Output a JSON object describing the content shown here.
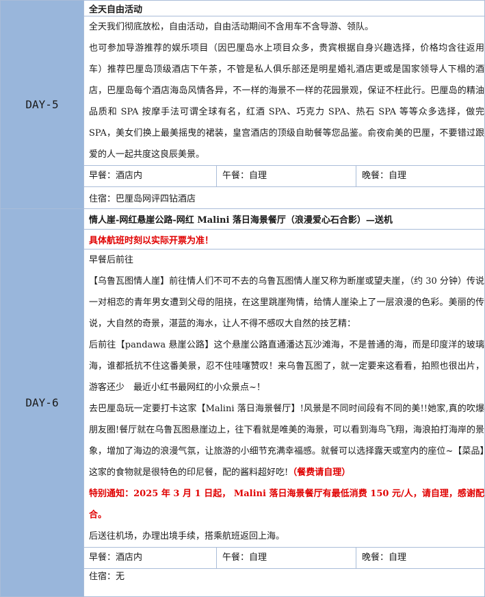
{
  "day5": {
    "label": "DAY-5",
    "title": "全天自由活动",
    "paragraphs": [
      "全天我们彻底放松，自由活动，自由活动期间不含用车不含导游、领队。",
      "也可参加导游推荐的娱乐项目（因巴厘岛水上项目众多，贵宾根据自身兴趣选择，价格均含往返用车）推荐巴厘岛顶级酒店下午茶，不管是私人俱乐部还是明星婚礼酒店更或是国家领导人下榻的酒店，巴厘岛每个酒店海岛风情各异，不一样的海景不一样的花园景观，保证不枉此行。巴厘岛的精油品质和 SPA 按摩手法可谓全球有名，红酒 SPA、巧克力 SPA、热石 SPA 等等众多选择，做完 SPA，美女们换上最美摇曳的裙装，皇宫酒店的顶级自助餐等您品鉴。俞夜俞美的巴厘，不要错过跟爱的人一起共度这良辰美景。"
    ],
    "breakfast": "早餐：酒店内",
    "lunch": "午餐：自理",
    "dinner": "晚餐：自理",
    "stay": "住宿：巴厘岛网评四钻酒店"
  },
  "day6": {
    "label": "DAY-6",
    "title": "情人崖-网红悬崖公路-网红 Malini 落日海景餐厅（浪漫爱心石合影）—送机",
    "flight_note": "具体航班时刻以实际开票为准！",
    "p1": "早餐后前往",
    "p2": "【乌鲁瓦图情人崖】前往情人们不可不去的乌鲁瓦图情人崖又称为断崖或望夫崖，（约 30 分钟）传说一对相恋的青年男女遭到父母的阻挠，在这里跳崖殉情，给情人崖染上了一层浪漫的色彩。美丽的传说，大自然的奇景，湛蓝的海水，让人不得不感叹大自然的技艺精：",
    "p3": "后前往【pandawa 悬崖公路】这个悬崖公路直通潘达瓦沙滩海，不是普通的海，而是印度洋的玻璃海，谁都抵抗不住这番美景，忍不住哇噻赞叹！来乌鲁瓦图了，就一定要来这看看，拍照也很出片，游客还少　最近小红书最网红的小众景点~！",
    "p4_main": "去巴厘岛玩一定要打卡这家【Malini 落日海景餐厅】!风景是不同时间段有不同的美!!她家,真的吹爆朋友圈!餐厅就在乌鲁瓦图悬崖边上，往下看就是唯美的海景，可以看到海鸟飞翔，海浪拍打海岸的景象，增加了海边的浪漫气氛，让旅游的小细节充满幸福感。就餐可以选择露天或室内的座位~【菜品】这家的食物就是很特色的印尼餐，配的酱料超好吃!",
    "p4_red": "（餐费请自理）",
    "p5": "特别通知：2025 年 3 月 1 日起， Malini 落日海景餐厅有最低消费 150 元/人，请自理，感谢配合。",
    "p6": "后送往机场，办理出境手续，搭乘航班返回上海。",
    "breakfast": "早餐：酒店内",
    "lunch": "午餐：自理",
    "dinner": "晚餐：自理",
    "stay": "住宿：无"
  }
}
